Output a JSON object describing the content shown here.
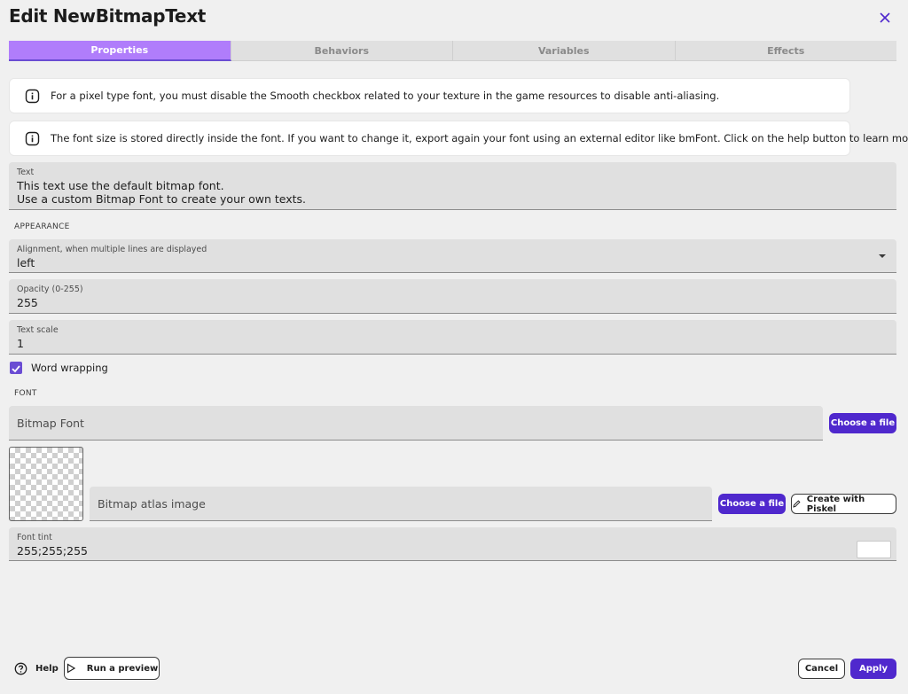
{
  "header": {
    "title": "Edit NewBitmapText"
  },
  "tabs": [
    {
      "label": "Properties"
    },
    {
      "label": "Behaviors"
    },
    {
      "label": "Variables"
    },
    {
      "label": "Effects"
    }
  ],
  "infos": [
    "For a pixel type font, you must disable the Smooth checkbox related to your texture in the game resources to disable anti-aliasing.",
    "The font size is stored directly inside the font. If you want to change it, export again your font using an external editor like bmFont. Click on the help button to learn more."
  ],
  "text_field": {
    "label": "Text",
    "line1": "This text use the default bitmap font.",
    "line2": "Use a custom Bitmap Font to create your own texts."
  },
  "appearance": {
    "heading": "APPEARANCE",
    "alignment": {
      "label": "Alignment, when multiple lines are displayed",
      "value": "left"
    },
    "opacity": {
      "label": "Opacity (0-255)",
      "value": "255"
    },
    "scale": {
      "label": "Text scale",
      "value": "1"
    },
    "word_wrap": {
      "label": "Word wrapping",
      "checked": true
    }
  },
  "font": {
    "heading": "FONT",
    "bitmap_font": {
      "placeholder": "Bitmap Font",
      "button": "Choose a file"
    },
    "atlas": {
      "placeholder": "Bitmap atlas image",
      "button": "Choose a file",
      "piskel_button": "Create with Piskel"
    },
    "tint": {
      "label": "Font tint",
      "value": "255;255;255",
      "color": "#ffffff"
    }
  },
  "footer": {
    "help": "Help",
    "preview": "Run a preview",
    "cancel": "Cancel",
    "apply": "Apply"
  },
  "colors": {
    "accent": "#4f28cd",
    "tab_active": "#b07dfb",
    "checkbox": "#6a4cd3"
  }
}
